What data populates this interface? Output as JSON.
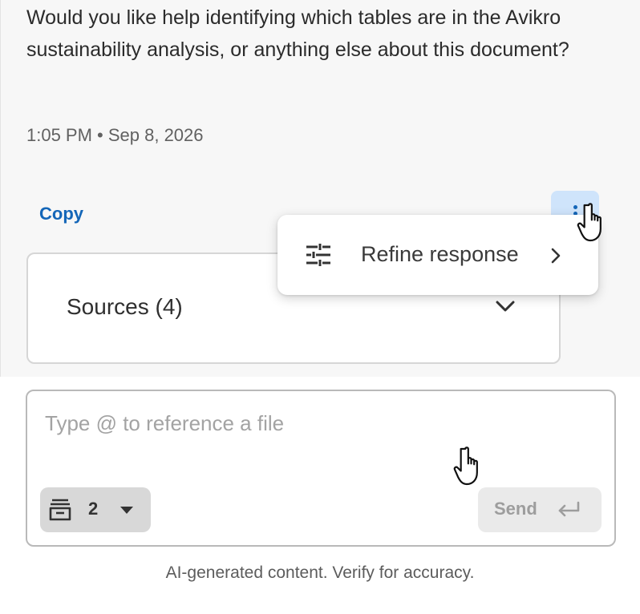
{
  "message": {
    "text": "Would you like help identifying which tables are in the Avikro sustainability analysis, or anything else about this document?",
    "timestamp": "1:05 PM • Sep 8, 2026"
  },
  "actions": {
    "copy_label": "Copy",
    "more_icon": "more-vertical-icon"
  },
  "menu": {
    "items": [
      {
        "label": "Refine response",
        "icon": "tune-icon",
        "trailing_icon": "chevron-right-icon"
      }
    ]
  },
  "sources": {
    "label": "Sources (4)",
    "icon": "chevron-down-icon"
  },
  "composer": {
    "placeholder": "Type @ to reference a file",
    "doc_count": "2",
    "doc_icon": "document-stack-icon",
    "send_label": "Send",
    "send_icon": "enter-icon"
  },
  "footer": {
    "disclaimer": "AI-generated content. Verify for accuracy."
  },
  "colors": {
    "accent": "#1466b8",
    "more_button_bg": "#cfe4fb",
    "chat_bg": "#f7f7f7"
  }
}
